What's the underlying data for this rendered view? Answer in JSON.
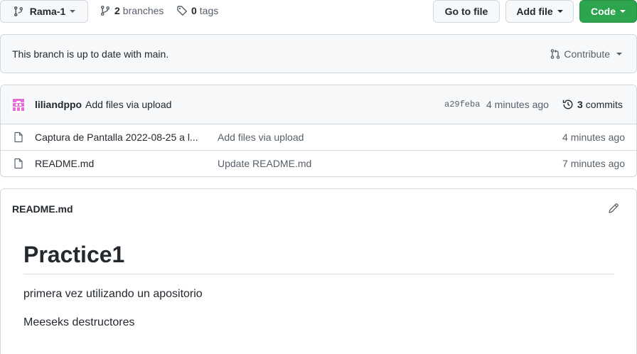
{
  "toolbar": {
    "branch": "Rama-1",
    "branches_count": "2",
    "branches_label": "branches",
    "tags_count": "0",
    "tags_label": "tags",
    "go_to_file": "Go to file",
    "add_file": "Add file",
    "code": "Code"
  },
  "status": {
    "text": "This branch is up to date with main.",
    "contribute": "Contribute"
  },
  "commit": {
    "author": "liliandppo",
    "message": "Add files via upload",
    "sha": "a29feba",
    "age": "4 minutes ago",
    "commits_count": "3",
    "commits_label": "commits"
  },
  "files": [
    {
      "name": "Captura de Pantalla 2022-08-25 a l...",
      "message": "Add files via upload",
      "age": "4 minutes ago"
    },
    {
      "name": "README.md",
      "message": "Update README.md",
      "age": "7 minutes ago"
    }
  ],
  "readme": {
    "file_title": "README.md",
    "heading": "Practice1",
    "paragraphs": [
      "primera vez utilizando un apositorio",
      "Meeseks destructores"
    ]
  },
  "colors": {
    "accent_green": "#2da44e",
    "avatar_pink": "#e86cd6"
  }
}
